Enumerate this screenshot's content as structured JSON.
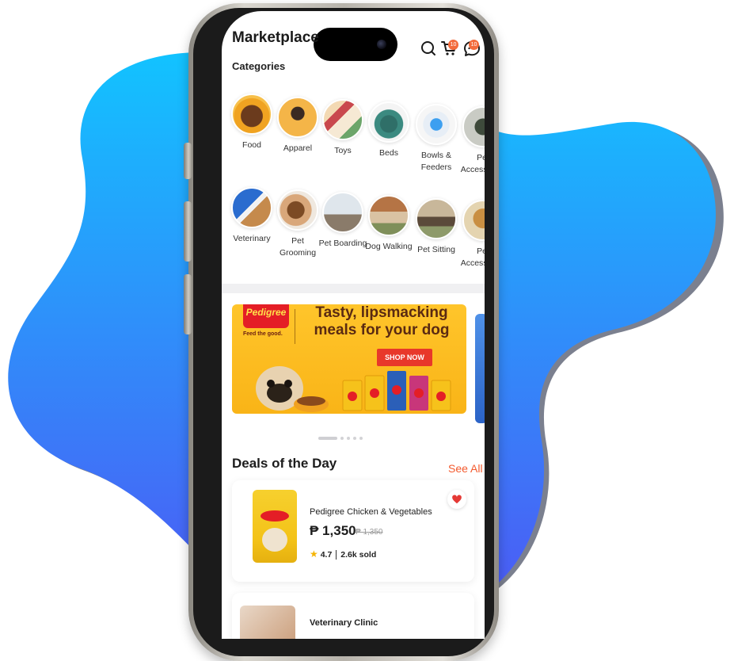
{
  "app": {
    "title": "Marketplace",
    "cart_badge": "10",
    "chat_badge": "10"
  },
  "categories": {
    "heading": "Categories",
    "row1": [
      {
        "label": "Food",
        "icon": "food-bowl-icon"
      },
      {
        "label": "Apparel",
        "icon": "dog-apparel-icon"
      },
      {
        "label": "Toys",
        "icon": "toys-icon"
      },
      {
        "label": "Beds",
        "icon": "bed-icon"
      },
      {
        "label": "Bowls & Feeders",
        "icon": "water-bowl-icon"
      },
      {
        "label": "Pet Accessories",
        "icon": "accessories-icon"
      }
    ],
    "row2": [
      {
        "label": "Veterinary",
        "icon": "veterinary-icon"
      },
      {
        "label": "Pet Grooming",
        "icon": "grooming-icon"
      },
      {
        "label": "Pet Boarding",
        "icon": "boarding-icon"
      },
      {
        "label": "Dog Walking",
        "icon": "dog-walking-icon"
      },
      {
        "label": "Pet Sitting",
        "icon": "pet-sitting-icon"
      },
      {
        "label": "Pet Accessories",
        "icon": "accessories-icon"
      }
    ]
  },
  "banner": {
    "brand": "Pedigree",
    "tagline": "Feed the good.",
    "headline": "Tasty, lipsmacking meals for your dog",
    "cta": "SHOP NOW",
    "slides": 5,
    "active_slide": 1
  },
  "deals": {
    "title": "Deals of the Day",
    "see_all": "See All",
    "items": [
      {
        "name": "Pedigree Chicken & Vegetables",
        "price": "₱ 1,350",
        "old_price": "₱ 1,350",
        "rating": "4.7",
        "sold": "2.6k sold",
        "favorited": true
      },
      {
        "name": "Veterinary Clinic"
      }
    ]
  },
  "colors": {
    "accent": "#F35A2E",
    "blob_top": "#12C3FF",
    "blob_bottom": "#4C5BF5",
    "banner_yellow": "#FFC52B"
  }
}
